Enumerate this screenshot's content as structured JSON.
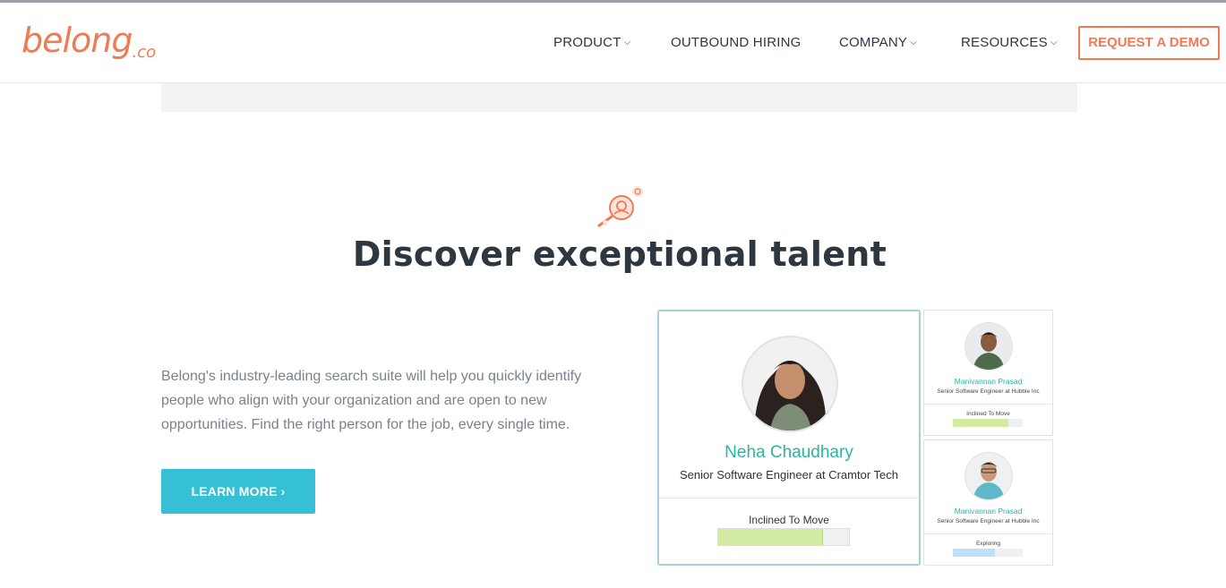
{
  "brand": {
    "logo_main": "belong",
    "logo_sub": ".co",
    "accent_color": "#f07a55"
  },
  "nav": {
    "items": [
      {
        "label": "PRODUCT",
        "has_dropdown": true
      },
      {
        "label": "OUTBOUND HIRING",
        "has_dropdown": false
      },
      {
        "label": "COMPANY",
        "has_dropdown": true
      },
      {
        "label": "RESOURCES",
        "has_dropdown": true
      }
    ],
    "dropdown_glyph": "⌵",
    "cta_label": "REQUEST A DEMO"
  },
  "hero": {
    "icon": "magnifier-person-icon",
    "headline": "Discover exceptional talent",
    "description": "Belong's industry-leading search suite will help you quickly identify people who align with your organization and are open to new opportunities. Find the right person for the job, every single time.",
    "button_label": "LEARN MORE ›",
    "button_color": "#35c0d6"
  },
  "profiles": {
    "main": {
      "name": "Neha Chaudhary",
      "role": "Senior Software Engineer at Cramtor Tech",
      "status": "Inclined To Move",
      "level": 0.8,
      "bar_color": "#d3eba3"
    },
    "side": [
      {
        "name": "Manivannan Prasad",
        "role": "Senior Software Engineer at Hubble Inc",
        "status": "Inclined To Move",
        "level": 0.8,
        "bar_color": "#d3eba3"
      },
      {
        "name": "Manivannan Prasad",
        "role": "Senior Software Engineer at Hubble Inc",
        "status": "Exploring",
        "level": 0.6,
        "bar_color": "#bfe1f7"
      }
    ]
  }
}
